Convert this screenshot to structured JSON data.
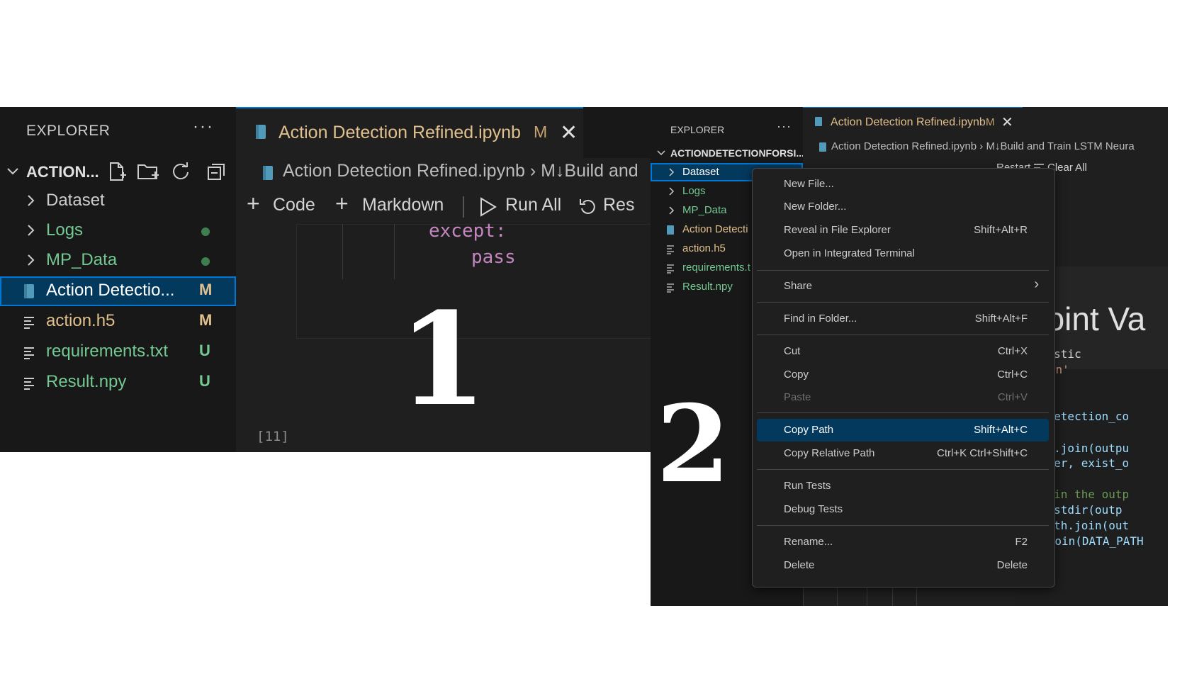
{
  "panel1": {
    "explorer_title": "EXPLORER",
    "more_actions": "···",
    "folder_title": "ACTION...",
    "tree": [
      {
        "label": "Dataset",
        "kind": "folder",
        "color": "#cccccc"
      },
      {
        "label": "Logs",
        "kind": "folder",
        "color": "#73c991",
        "status": "dot"
      },
      {
        "label": "MP_Data",
        "kind": "folder",
        "color": "#73c991",
        "status": "dot"
      },
      {
        "label": "Action Detectio...",
        "kind": "notebook",
        "color": "#ffffff",
        "badge": "M",
        "selected": true
      },
      {
        "label": "action.h5",
        "kind": "file",
        "color": "#e2c08d",
        "badge": "M"
      },
      {
        "label": "requirements.txt",
        "kind": "file",
        "color": "#73c991",
        "badge": "U"
      },
      {
        "label": "Result.npy",
        "kind": "file",
        "color": "#73c991",
        "badge": "U"
      }
    ],
    "tab": {
      "title": "Action Detection Refined.ipynb",
      "modified": "M",
      "close": "✕"
    },
    "breadcrumb": "Action Detection Refined.ipynb › M↓Build and",
    "toolbar": {
      "code": "Code",
      "markdown": "Markdown",
      "run_all": "Run All",
      "restart": "Res"
    },
    "code": {
      "line1": "except:",
      "line2": "pass"
    },
    "exec_count": "[11]",
    "step_number": "1"
  },
  "panel2": {
    "explorer_title": "EXPLORER",
    "more_actions": "···",
    "folder_title": "ACTIONDETECTIONFORSI...",
    "tree": [
      {
        "label": "Dataset",
        "kind": "folder",
        "color": "#cccccc",
        "selected": true
      },
      {
        "label": "Logs",
        "kind": "folder",
        "color": "#73c991"
      },
      {
        "label": "MP_Data",
        "kind": "folder",
        "color": "#73c991"
      },
      {
        "label": "Action Detecti",
        "kind": "notebook",
        "color": "#e2c08d"
      },
      {
        "label": "action.h5",
        "kind": "file",
        "color": "#e2c08d"
      },
      {
        "label": "requirements.t",
        "kind": "file",
        "color": "#73c991"
      },
      {
        "label": "Result.npy",
        "kind": "file",
        "color": "#73c991"
      }
    ],
    "tab": {
      "title": "Action Detection Refined.ipynb",
      "modified": "M",
      "close": "✕"
    },
    "breadcrumb": "Action Detection Refined.ipynb › M↓Build and Train LSTM Neura",
    "toolbar": {
      "restart": "Restart",
      "clear_all": "Clear All"
    },
    "markdown_heading": "point Va",
    "code_lines": [
      {
        "text": ".holistic",
        "color": "#d4d4d4"
      },
      {
        "text": "ision'",
        "color": "#ce9178"
      },
      {
        "text": "min_detection_co",
        "color": "#9cdcfe"
      },
      {
        "text": ".path.join(outpu",
        "color": "#9cdcfe"
      },
      {
        "text": "_folder, exist_o",
        "color": "#9cdcfe"
      },
      {
        "text": "ders in the outp",
        "color": "#6a9955"
      },
      {
        "text": " os.listdir(outp",
        "color": "#9cdcfe"
      },
      {
        "text": "os.path.join(out",
        "color": "#9cdcfe"
      },
      {
        "text": "output = os.path.join(DATA_PATH",
        "color": "#9cdcfe"
      }
    ],
    "step_number": "2",
    "context_menu": [
      {
        "label": "New File...",
        "shortcut": ""
      },
      {
        "label": "New Folder...",
        "shortcut": ""
      },
      {
        "label": "Reveal in File Explorer",
        "shortcut": "Shift+Alt+R"
      },
      {
        "label": "Open in Integrated Terminal",
        "shortcut": ""
      },
      {
        "separator": true
      },
      {
        "label": "Share",
        "shortcut": "›",
        "submenu": true
      },
      {
        "separator": true
      },
      {
        "label": "Find in Folder...",
        "shortcut": "Shift+Alt+F"
      },
      {
        "separator": true
      },
      {
        "label": "Cut",
        "shortcut": "Ctrl+X"
      },
      {
        "label": "Copy",
        "shortcut": "Ctrl+C"
      },
      {
        "label": "Paste",
        "shortcut": "Ctrl+V",
        "disabled": true
      },
      {
        "separator": true
      },
      {
        "label": "Copy Path",
        "shortcut": "Shift+Alt+C",
        "highlighted": true
      },
      {
        "label": "Copy Relative Path",
        "shortcut": "Ctrl+K Ctrl+Shift+C"
      },
      {
        "separator": true
      },
      {
        "label": "Run Tests",
        "shortcut": ""
      },
      {
        "label": "Debug Tests",
        "shortcut": ""
      },
      {
        "separator": true
      },
      {
        "label": "Rename...",
        "shortcut": "F2"
      },
      {
        "label": "Delete",
        "shortcut": "Delete"
      }
    ]
  },
  "colors": {
    "sidebar_bg": "#181818",
    "editor_bg": "#1f1f1f",
    "accent": "#0078d4",
    "selection": "#04395e",
    "modified": "#e2c08d",
    "untracked": "#73c991",
    "keyword": "#c586c0"
  }
}
